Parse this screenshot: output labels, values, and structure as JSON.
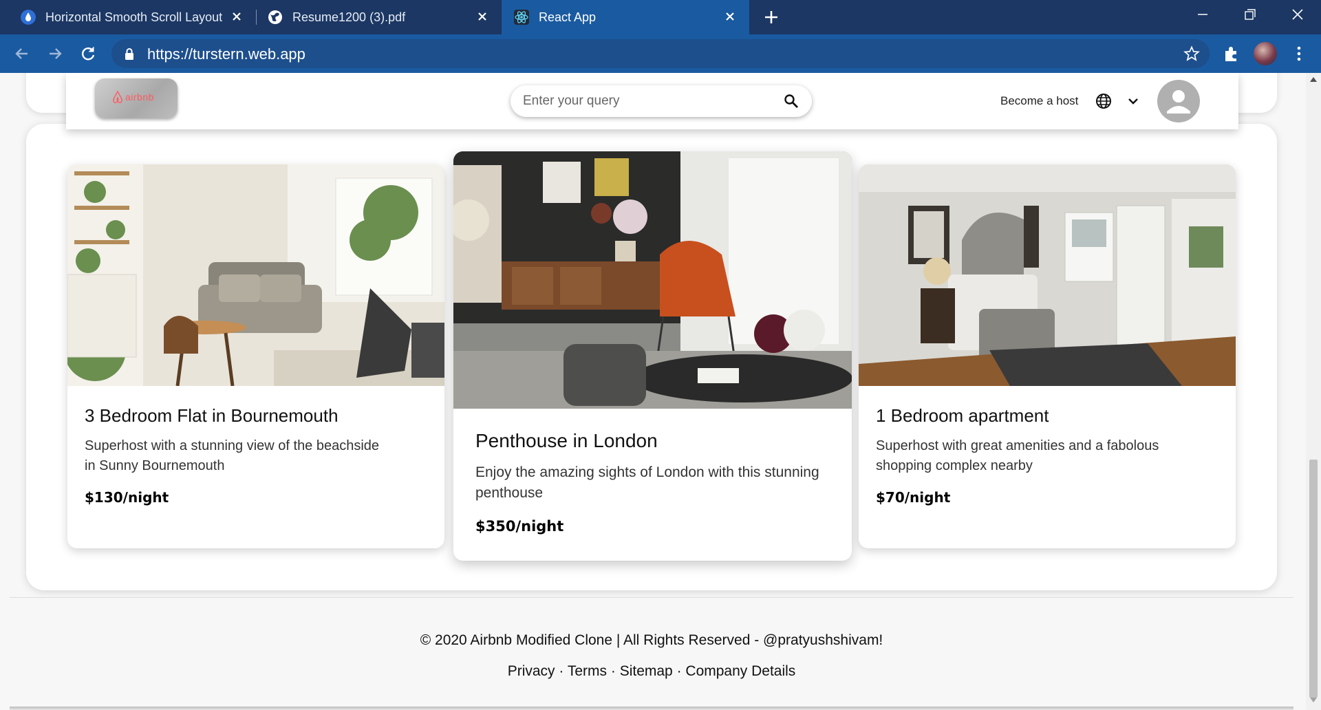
{
  "browser": {
    "tabs": [
      {
        "title": "Horizontal Smooth Scroll Layout",
        "favicon": "drop-icon"
      },
      {
        "title": "Resume1200 (3).pdf",
        "favicon": "globe-icon"
      },
      {
        "title": "React App",
        "favicon": "react-icon"
      }
    ],
    "url": "https://turstern.web.app"
  },
  "header": {
    "logo_text": "airbnb",
    "search_placeholder": "Enter your query",
    "host_link": "Become a host"
  },
  "cards": [
    {
      "title": "3 Bedroom Flat in Bournemouth",
      "description": "Superhost with a stunning view of the beachside in Sunny Bournemouth",
      "price": "$130/night"
    },
    {
      "title": "Penthouse in London",
      "description": "Enjoy the amazing sights of London with this stunning penthouse",
      "price": "$350/night"
    },
    {
      "title": "1 Bedroom apartment",
      "description": "Superhost with great amenities and a fabolous shopping complex nearby",
      "price": "$70/night"
    }
  ],
  "footer": {
    "copyright": "© 2020 Airbnb Modified Clone | All Rights Reserved - @pratyushshivam!",
    "links": [
      "Privacy",
      "Terms",
      "Sitemap",
      "Company Details"
    ],
    "separator": " · "
  },
  "colors": {
    "tabstrip": "#1c3763",
    "toolbar": "#1a5aa0",
    "brand": "#ff5a5f"
  }
}
